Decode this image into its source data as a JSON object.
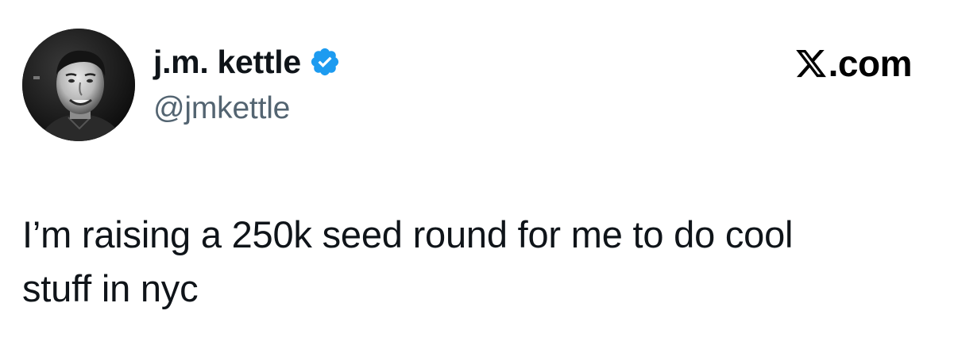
{
  "tweet": {
    "author": {
      "display_name": "j.m. kettle",
      "handle": "@jmkettle",
      "verified": true,
      "avatar_icon": "profile-photo"
    },
    "source": {
      "logo_icon": "x-logo-icon",
      "domain": ".com"
    },
    "text": "I’m raising a 250k seed round for me to do cool\nstuff in nyc"
  },
  "colors": {
    "text_primary": "#0f1419",
    "text_secondary": "#536471",
    "verified_blue": "#1d9bf0",
    "background": "#ffffff"
  }
}
